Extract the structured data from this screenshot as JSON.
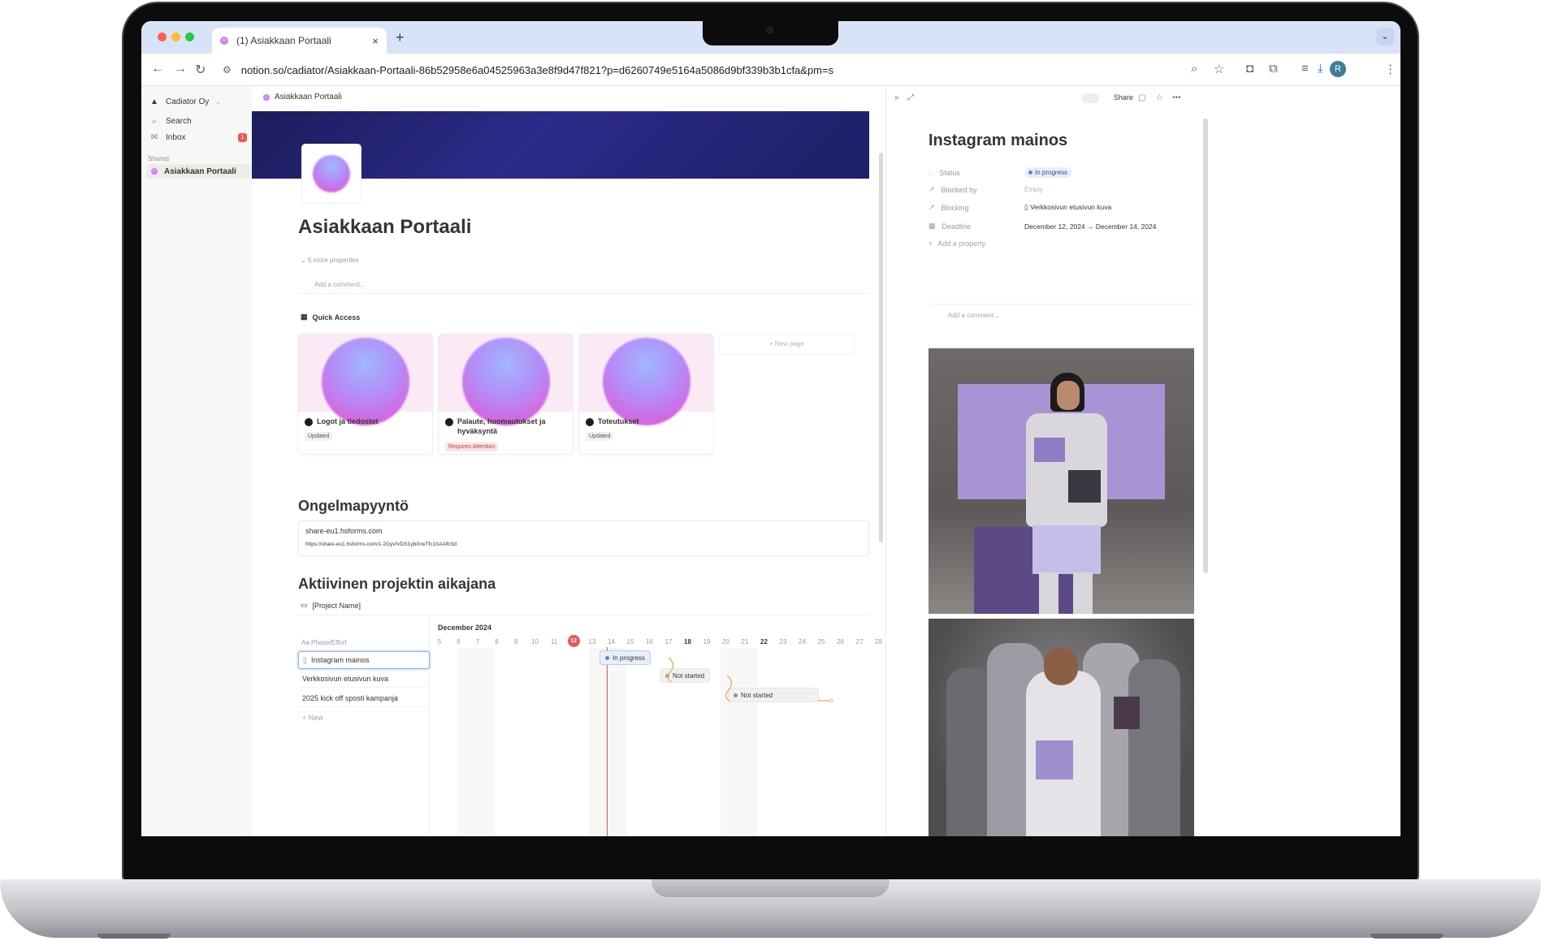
{
  "browser": {
    "tab_title": "(1) Asiakkaan Portaali",
    "tab_close": "×",
    "new_tab": "+",
    "url": "notion.so/cadiator/Asiakkaan-Portaali-86b52958e6a04525963a3e8f9d47f821?p=d6260749e5164a5086d9bf339b3b1cfa&pm=s",
    "profile_initial": "R",
    "tab_menu": "⌄"
  },
  "sidebar": {
    "workspace": "Cadiator Oy",
    "search": "Search",
    "inbox": "Inbox",
    "inbox_count": "1",
    "shared_label": "Shared",
    "shared_page": "Asiakkaan Portaali"
  },
  "page": {
    "breadcrumb": "Asiakkaan Portaali",
    "title": "Asiakkaan Portaali",
    "more_properties": "5 more properties",
    "add_comment": "Add a comment...",
    "quick_access": "Quick Access",
    "cards": [
      {
        "title": "Logot ja tiedostot",
        "tag": "Updated"
      },
      {
        "title": "Palaute, huomautukset ja hyväksyntä",
        "tag": "Requires Attention"
      },
      {
        "title": "Toteutukset",
        "tag": "Updated"
      }
    ],
    "new_page": "+ New page",
    "problem_heading": "Ongelmapyyntö",
    "embed_domain": "share-eu1.hsforms.com",
    "embed_url": "https://share-eu1.hsforms.com/1-2GyvIVDS1ybXrwTfc1XAAftr3d",
    "timeline_heading": "Aktiivinen projektin aikajana",
    "project_name": "[Project Name]"
  },
  "timeline": {
    "month": "December 2024",
    "column_header": "Aa Phase/Effort",
    "days": [
      "5",
      "6",
      "7",
      "8",
      "9",
      "10",
      "11",
      "12",
      "13",
      "14",
      "15",
      "16",
      "17",
      "18",
      "19",
      "20",
      "21",
      "22",
      "23",
      "24",
      "25",
      "26",
      "27",
      "28"
    ],
    "today": "12",
    "rows": [
      {
        "name": "Instagram mainos",
        "status": "In progress"
      },
      {
        "name": "Verkkosivun etusivun kuva",
        "status": "Not started"
      },
      {
        "name": "2025 kick off sposti kampanja",
        "status": "Not started"
      }
    ],
    "new_row": "+ New"
  },
  "panel": {
    "share": "Share",
    "title": "Instagram mainos",
    "properties": [
      {
        "key": "Status",
        "value": "In progress"
      },
      {
        "key": "Blocked by",
        "value": "Empty"
      },
      {
        "key": "Blocking",
        "value": "Verkkosivun etusivun kuva"
      },
      {
        "key": "Deadline",
        "value": "December 12, 2024 → December 14, 2024"
      }
    ],
    "add_property": "Add a property",
    "add_comment": "Add a comment..."
  },
  "colors": {
    "accent_red": "#eb5757",
    "status_blue": "#5e87c9",
    "cover_navy": "#1b1d5c",
    "chrome_blue": "#d8e3f8"
  }
}
